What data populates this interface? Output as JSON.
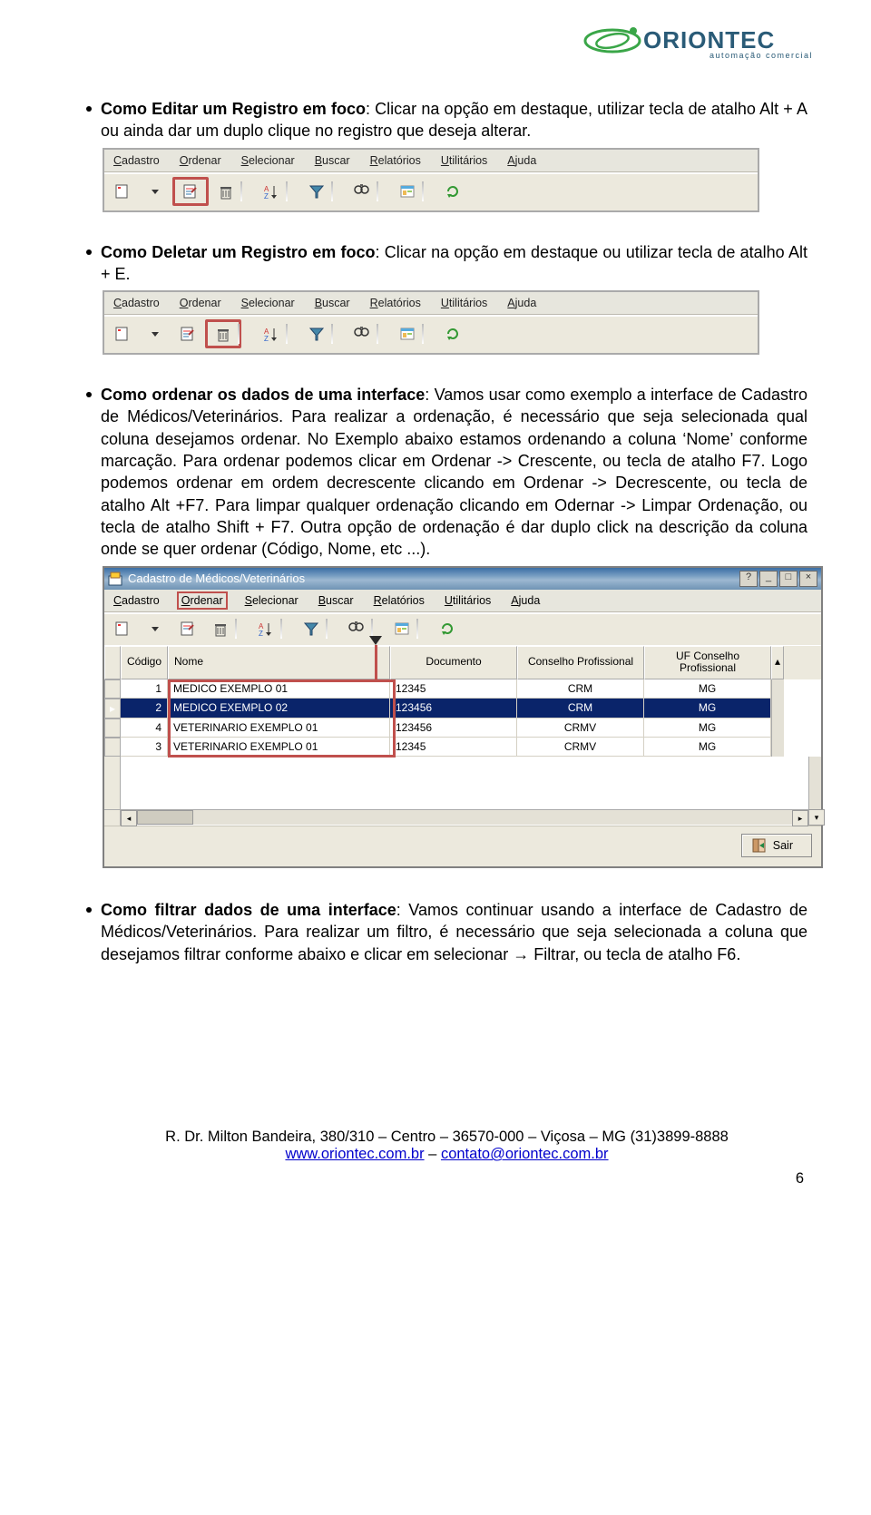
{
  "logo": {
    "brand": "ORIONTEC",
    "sub": "automação comercial"
  },
  "menu": {
    "cadastro": "Cadastro",
    "ordenar": "Ordenar",
    "selecionar": "Selecionar",
    "buscar": "Buscar",
    "relatorios": "Relatórios",
    "utilitarios": "Utilitários",
    "ajuda": "Ajuda"
  },
  "section1": {
    "title": "Como Editar um Registro em foco",
    "text": ": Clicar na opção em destaque, utilizar tecla de atalho Alt + A ou ainda dar um duplo clique no registro que deseja alterar."
  },
  "section2": {
    "title": "Como Deletar um Registro em foco",
    "text": ": Clicar na opção em destaque ou utilizar tecla de atalho Alt + E."
  },
  "section3": {
    "title": "Como ordenar os dados de uma interface",
    "text": ": Vamos usar como exemplo a interface de Cadastro de Médicos/Veterinários. Para realizar a ordenação, é necessário que seja selecionada qual coluna desejamos ordenar. No Exemplo abaixo estamos ordenando a coluna ‘Nome’ conforme marcação. Para ordenar podemos clicar em Ordenar -> Crescente, ou tecla de atalho F7. Logo podemos ordenar em ordem decrescente clicando em Ordenar -> Decrescente, ou tecla de atalho Alt +F7. Para limpar qualquer ordenação clicando em Odernar -> Limpar Ordenação, ou tecla de atalho Shift + F7. Outra opção de ordenação é dar duplo click na descrição da coluna onde se quer ordenar (Código, Nome, etc ...)."
  },
  "section4": {
    "title": "Como filtrar dados de uma interface",
    "text": ": Vamos continuar usando a interface de Cadastro de Médicos/Veterinários. Para realizar um filtro, é necessário que seja selecionada a coluna que desejamos filtrar conforme abaixo e clicar em selecionar → Filtrar, ou tecla de atalho F6."
  },
  "window": {
    "title": "Cadastro de Médicos/Veterinários",
    "sair": "Sair",
    "headers": {
      "codigo": "Código",
      "nome": "Nome",
      "documento": "Documento",
      "conselho": "Conselho Profissional",
      "uf": "UF Conselho Profissional"
    },
    "rows": [
      {
        "codigo": "1",
        "nome": "MEDICO EXEMPLO 01",
        "doc": "12345",
        "cons": "CRM",
        "uf": "MG",
        "sel": false
      },
      {
        "codigo": "2",
        "nome": "MEDICO EXEMPLO 02",
        "doc": "123456",
        "cons": "CRM",
        "uf": "MG",
        "sel": true
      },
      {
        "codigo": "4",
        "nome": "VETERINARIO EXEMPLO 01",
        "doc": "123456",
        "cons": "CRMV",
        "uf": "MG",
        "sel": false
      },
      {
        "codigo": "3",
        "nome": "VETERINARIO EXEMPLO 01",
        "doc": "12345",
        "cons": "CRMV",
        "uf": "MG",
        "sel": false
      }
    ]
  },
  "footer": {
    "addr": "R. Dr. Milton Bandeira, 380/310 – Centro – 36570-000 – Viçosa – MG (31)3899-8888",
    "site": "www.oriontec.com.br",
    "dash": " – ",
    "mail": "contato@oriontec.com.br",
    "page": "6"
  }
}
